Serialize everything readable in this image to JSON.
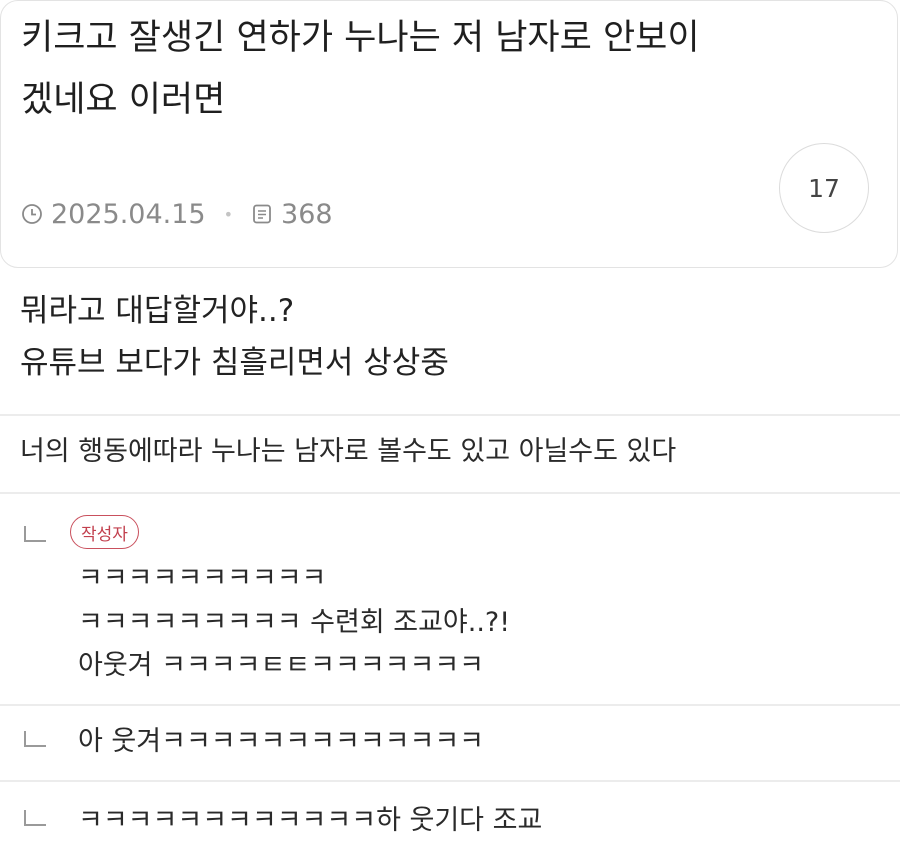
{
  "post": {
    "title_line1": "키크고 잘생긴 연하가 누나는 저 남자로 안보이",
    "title_line2": "겠네요 이러면",
    "date": "2025.04.15",
    "views": "368",
    "comment_count": "17",
    "body_line1": "뭐라고 대답할거야..?",
    "body_line2": "유튜브 보다가 침흘리면서 상상중"
  },
  "comments": [
    {
      "text": "너의 행동에따라 누나는 남자로 볼수도 있고 아닐수도 있다"
    }
  ],
  "replies": [
    {
      "badge": "작성자",
      "line1": "ㅋㅋㅋㅋㅋㅋㅋㅋㅋㅋ",
      "line2": "ㅋㅋㅋㅋㅋㅋㅋㅋㅋ 수련회 조교야..?!",
      "line3": "아웃겨 ㅋㅋㅋㅋㅌㅌㅋㅋㅋㅋㅋㅋㅋ"
    },
    {
      "line1": "아 웃겨ㅋㅋㅋㅋㅋㅋㅋㅋㅋㅋㅋㅋㅋ"
    },
    {
      "line1": "ㅋㅋㅋㅋㅋㅋㅋㅋㅋㅋㅋㅋ하 웃기다 조교"
    }
  ],
  "icons": {
    "date": "clock-icon",
    "views": "document-icon",
    "reply": "reply-arrow-icon"
  },
  "colors": {
    "author_badge": "#c2404e",
    "meta_text": "#8a8a8a",
    "divider": "#ececec"
  }
}
